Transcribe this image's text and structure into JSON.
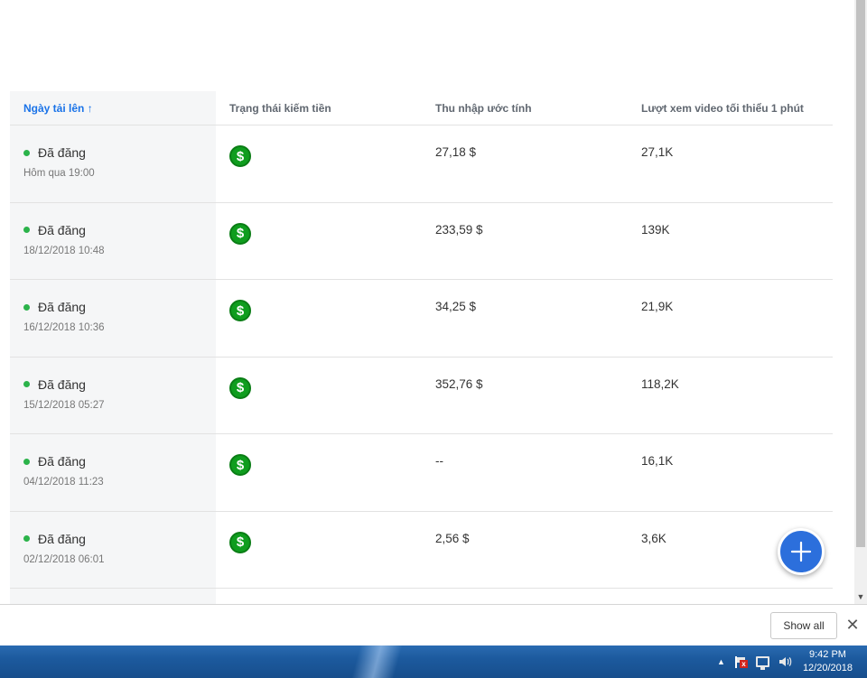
{
  "table": {
    "headers": {
      "upload_date": "Ngày tải lên ↑",
      "monetization": "Trạng thái kiếm tiền",
      "earnings": "Thu nhập ước tính",
      "views": "Lượt xem video tối thiểu 1 phút"
    },
    "rows": [
      {
        "status": "Đã đăng",
        "date": "Hôm qua 19:00",
        "earnings": "27,18 $",
        "views": "27,1K"
      },
      {
        "status": "Đã đăng",
        "date": "18/12/2018 10:48",
        "earnings": "233,59 $",
        "views": "139K"
      },
      {
        "status": "Đã đăng",
        "date": "16/12/2018 10:36",
        "earnings": "34,25 $",
        "views": "21,9K"
      },
      {
        "status": "Đã đăng",
        "date": "15/12/2018 05:27",
        "earnings": "352,76 $",
        "views": "118,2K"
      },
      {
        "status": "Đã đăng",
        "date": "04/12/2018 11:23",
        "earnings": "--",
        "views": "16,1K"
      },
      {
        "status": "Đã đăng",
        "date": "02/12/2018 06:01",
        "earnings": "2,56 $",
        "views": "3,6K"
      }
    ],
    "monetization_icon": "dollar-circle-icon",
    "status_color": "#2bb34a",
    "money_color": "#0f9d1e",
    "accent": "#1a73e8"
  },
  "fab": {
    "icon": "plus-icon",
    "color": "#2c6fdc"
  },
  "download_bar": {
    "show_all_label": "Show all",
    "close_symbol": "✕"
  },
  "taskbar": {
    "clock_time": "9:42 PM",
    "clock_date": "12/20/2018",
    "tray_arrow": "▲"
  }
}
